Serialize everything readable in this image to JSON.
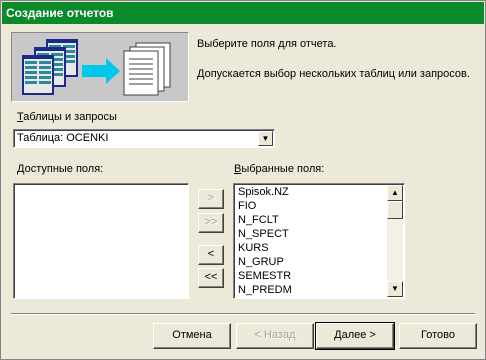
{
  "window": {
    "title": "Создание отчетов"
  },
  "header": {
    "line1": "Выберите поля для отчета.",
    "line2": "Допускается выбор нескольких таблиц или запросов."
  },
  "source": {
    "label_first": "Т",
    "label_rest": "аблицы и запросы",
    "selected": "Таблица: OCENKI"
  },
  "available": {
    "label_first": "Д",
    "label_rest": "оступные поля:",
    "items": []
  },
  "selected_fields": {
    "label_first": "В",
    "label_rest": "ыбранные поля:",
    "items": [
      "Spisok.NZ",
      "FIO",
      "N_FCLT",
      "N_SPECT",
      "KURS",
      "N_GRUP",
      "SEMESTR",
      "N_PREDM"
    ]
  },
  "move_buttons": {
    "add_one": ">",
    "add_all": ">>",
    "remove_one": "<",
    "remove_all": "<<"
  },
  "footer": {
    "cancel": "Отмена",
    "back": "< Назад",
    "next": "Далее >",
    "finish": "Готово"
  },
  "icons": {
    "combo_arrow": "chevron-down-icon",
    "scroll_up": "scroll-up-icon",
    "scroll_down": "scroll-down-icon"
  },
  "colors": {
    "titlebar": "#0a8a2a",
    "dialog_bg": "#ece9d8",
    "illustration_bg": "#c8c8c8"
  }
}
